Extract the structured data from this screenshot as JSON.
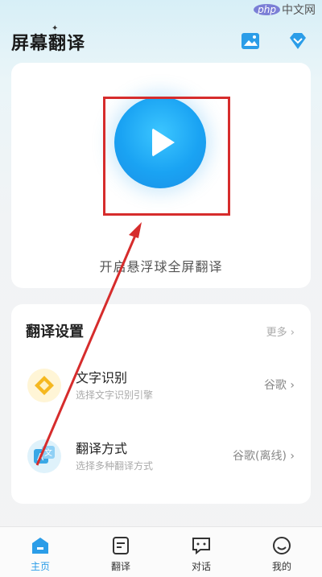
{
  "watermark": {
    "badge": "php",
    "text": "中文网"
  },
  "header": {
    "title": "屏幕翻译",
    "gallery_icon": "image-icon",
    "vip_icon": "diamond-icon"
  },
  "main_card": {
    "start_label": "开启悬浮球全屏翻译",
    "play_icon": "play-icon"
  },
  "settings": {
    "title": "翻译设置",
    "more": "更多 ›",
    "rows": [
      {
        "title": "文字识别",
        "subtitle": "选择文字识别引擎",
        "value": "谷歌 ›",
        "icon": "text-recognition-icon"
      },
      {
        "title": "翻译方式",
        "subtitle": "选择多种翻译方式",
        "value": "谷歌(离线) ›",
        "icon": "translate-icon"
      }
    ]
  },
  "nav": [
    {
      "label": "主页",
      "icon": "home-icon",
      "active": true
    },
    {
      "label": "翻译",
      "icon": "document-icon",
      "active": false
    },
    {
      "label": "对话",
      "icon": "chat-icon",
      "active": false
    },
    {
      "label": "我的",
      "icon": "profile-icon",
      "active": false
    }
  ],
  "colors": {
    "accent": "#2b9de8",
    "highlight": "#d62c2c",
    "play": "#1aa3f3"
  }
}
